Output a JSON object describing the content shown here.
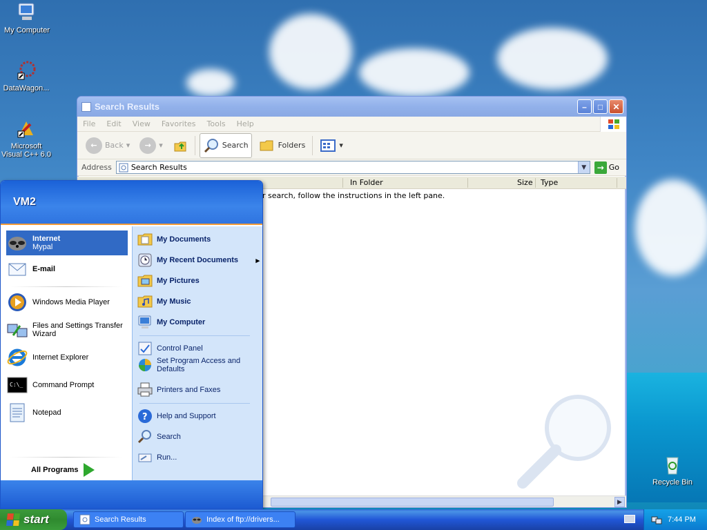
{
  "desktop": {
    "icons": [
      {
        "label": "My Computer"
      },
      {
        "label": "DataWagon..."
      },
      {
        "label": "Microsoft Visual C++ 6.0"
      },
      {
        "label": "Recycle Bin"
      }
    ]
  },
  "explorer": {
    "title": "Search Results",
    "menu": [
      "File",
      "Edit",
      "View",
      "Favorites",
      "Tools",
      "Help"
    ],
    "toolbar": {
      "back": "Back",
      "search": "Search",
      "folders": "Folders"
    },
    "address": {
      "label": "Address",
      "value": "Search Results",
      "go": "Go"
    },
    "columns": [
      "In Folder",
      "Size",
      "Type"
    ],
    "message": "r search, follow the instructions in the left pane."
  },
  "start_menu": {
    "user": "VM2",
    "pinned": [
      {
        "label": "Internet",
        "sub": "Mypal"
      },
      {
        "label": "E-mail"
      }
    ],
    "recent": [
      {
        "label": "Windows Media Player"
      },
      {
        "label": "Files and Settings Transfer Wizard"
      },
      {
        "label": "Internet Explorer"
      },
      {
        "label": "Command Prompt"
      },
      {
        "label": "Notepad"
      }
    ],
    "all_programs": "All Programs",
    "right": [
      {
        "label": "My Documents"
      },
      {
        "label": "My Recent Documents"
      },
      {
        "label": "My Pictures"
      },
      {
        "label": "My Music"
      },
      {
        "label": "My Computer"
      },
      {
        "label": "Control Panel"
      },
      {
        "label": "Set Program Access and Defaults"
      },
      {
        "label": "Printers and Faxes"
      },
      {
        "label": "Help and Support"
      },
      {
        "label": "Search"
      },
      {
        "label": "Run..."
      }
    ]
  },
  "taskbar": {
    "start": "start",
    "tasks": [
      {
        "label": "Search Results"
      },
      {
        "label": "Index of ftp://drivers..."
      }
    ],
    "clock": "7:44 PM"
  }
}
